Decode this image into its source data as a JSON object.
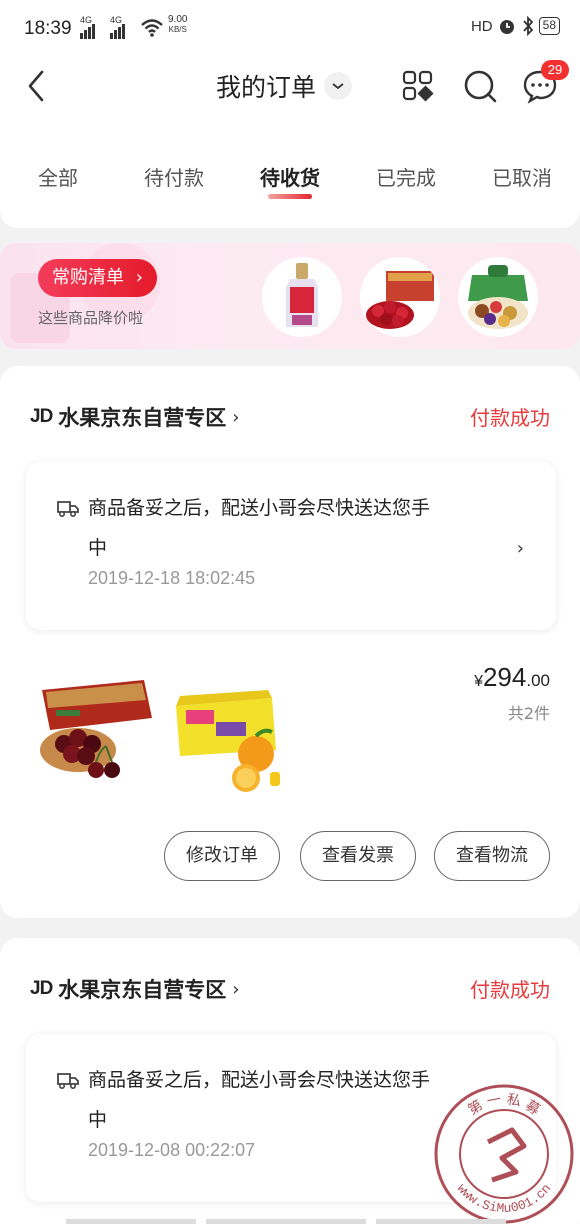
{
  "status_bar": {
    "time": "18:39",
    "net1": "4G",
    "net2": "4G",
    "speed_value": "9.00",
    "speed_unit": "KB/S",
    "hd_label": "HD",
    "battery": "58"
  },
  "header": {
    "title": "我的订单",
    "message_badge": "29"
  },
  "tabs": [
    {
      "label": "全部",
      "active": false
    },
    {
      "label": "待付款",
      "active": false
    },
    {
      "label": "待收货",
      "active": true
    },
    {
      "label": "已完成",
      "active": false
    },
    {
      "label": "已取消",
      "active": false
    }
  ],
  "banner": {
    "pill_label": "常购清单",
    "pill_chevron": "›",
    "subtitle": "这些商品降价啦"
  },
  "orders": [
    {
      "shop_logo": "JD",
      "shop_name": "水果京东自营专区",
      "shop_chevron": "›",
      "status": "付款成功",
      "delivery_line1": "商品备妥之后，配送小哥会尽快送达您手",
      "delivery_line2": "中",
      "delivery_time": "2019-12-18 18:02:45",
      "delivery_chevron": "›",
      "price_currency": "¥",
      "price_integer": "294",
      "price_decimal": ".00",
      "quantity": "共2件",
      "buttons": [
        "修改订单",
        "查看发票",
        "查看物流"
      ]
    },
    {
      "shop_logo": "JD",
      "shop_name": "水果京东自营专区",
      "shop_chevron": "›",
      "status": "付款成功",
      "delivery_line1": "商品备妥之后，配送小哥会尽快送达您手",
      "delivery_line2": "中",
      "delivery_time": "2019-12-08 00:22:07"
    }
  ],
  "watermark": {
    "text_top": "第 一 私 募",
    "text_bottom": "www.SiMu001.cn"
  },
  "colors": {
    "accent_red": "#e93b3d",
    "badge_red": "#f23030",
    "banner_pink": "#fbe2ee"
  }
}
